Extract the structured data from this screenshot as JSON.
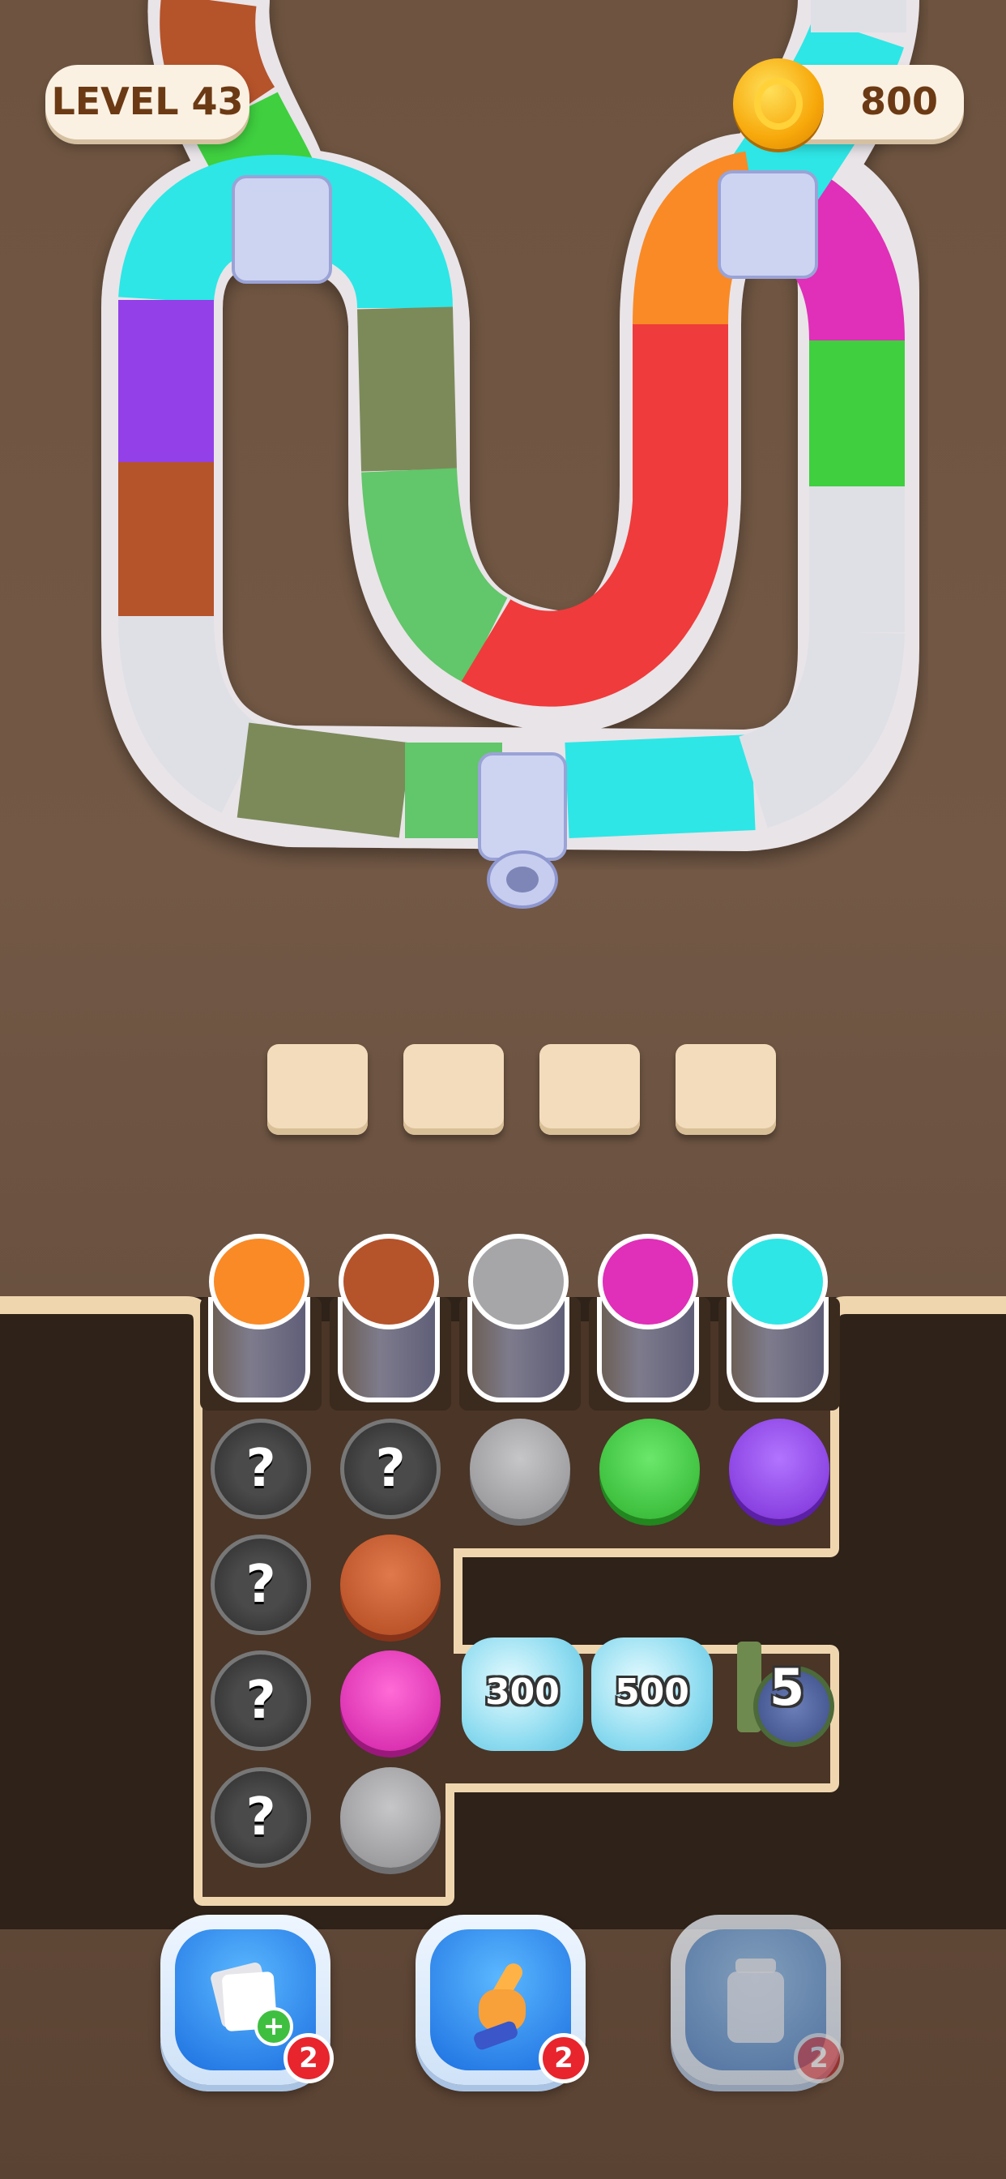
{
  "hud": {
    "level_label": "LEVEL 43",
    "coins": "800",
    "coin_icon": "gold-coin-icon"
  },
  "slots": [
    "",
    "",
    "",
    ""
  ],
  "jars": [
    {
      "color": "#f98a26"
    },
    {
      "color": "#b5532b"
    },
    {
      "color": "#a6a6a8"
    },
    {
      "color": "#e02fb8"
    },
    {
      "color": "#2ee6e6"
    }
  ],
  "grid_rows": [
    [
      {
        "type": "hidden",
        "label": "?"
      },
      {
        "type": "hidden",
        "label": "?"
      },
      {
        "type": "cap",
        "color": "#a3a3a5"
      },
      {
        "type": "cap",
        "color": "#3fcf3f"
      },
      {
        "type": "cap",
        "color": "#9340e8"
      }
    ],
    [
      {
        "type": "hidden",
        "label": "?"
      },
      {
        "type": "cap",
        "color": "#c2572e"
      }
    ],
    [
      {
        "type": "hidden",
        "label": "?"
      },
      {
        "type": "cap",
        "color": "#e02fb8"
      },
      {
        "type": "ice",
        "label": "300"
      },
      {
        "type": "ice",
        "label": "500"
      },
      {
        "type": "counter",
        "label": "5"
      }
    ],
    [
      {
        "type": "hidden",
        "label": "?"
      },
      {
        "type": "cap",
        "color": "#a3a3a5"
      }
    ]
  ],
  "boosters": [
    {
      "name": "add-cards",
      "count": "2",
      "icon": "cards-plus-icon"
    },
    {
      "name": "pick",
      "count": "2",
      "icon": "pointing-hand-icon"
    },
    {
      "name": "extra-jar",
      "count": "2",
      "icon": "jar-icon",
      "disabled": true
    }
  ],
  "tube_colors": [
    "#ffffff",
    "#3fcf3f",
    "#2ee6e6",
    "#9340e8",
    "#b5532b",
    "#dfe0e6",
    "#7c8a5a",
    "#ef3b3b",
    "#f98a26",
    "#e02fb8"
  ]
}
